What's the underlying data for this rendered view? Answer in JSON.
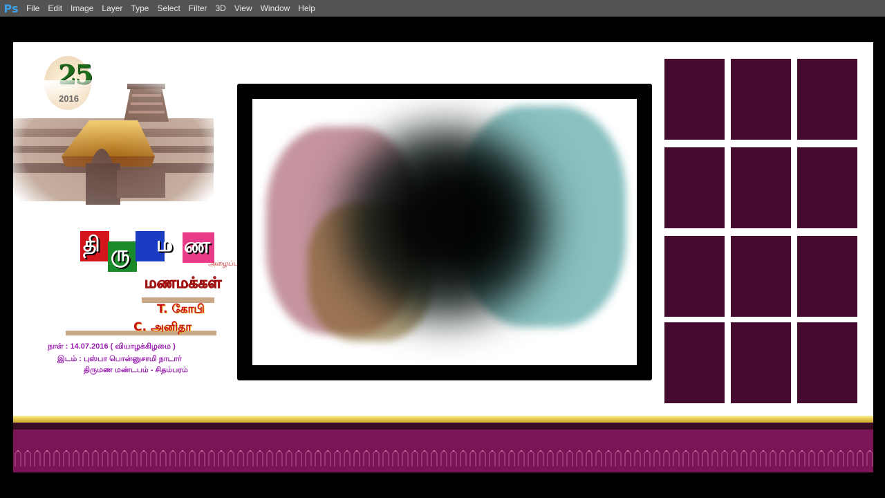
{
  "app": {
    "logo": "Ps"
  },
  "menu": [
    "File",
    "Edit",
    "Image",
    "Layer",
    "Type",
    "Select",
    "Filter",
    "3D",
    "View",
    "Window",
    "Help"
  ],
  "design": {
    "logo": {
      "number": "25",
      "year": "2016"
    },
    "title_blocks": [
      {
        "text": "தி",
        "color": "#d4151c"
      },
      {
        "text": "ரு",
        "color": "#1a8a2a"
      },
      {
        "text": "ம",
        "color": "#1a3cc2"
      },
      {
        "text": "ண",
        "color": "#e83c8a"
      }
    ],
    "title_sub": "அழைப்பு....",
    "heading": "மணமக்கள்",
    "groom": "T. கோபி",
    "bride": "C. அனிதா",
    "date_line": "நாள் : 14.07.2016 ( வியாழக்கிழமை )",
    "venue_line1": "இடம் :  புஸ்பா பொன்னுசாமி நாடார்",
    "venue_line2": "திருமண மண்டபம் - சிதம்பரம்"
  },
  "colors": {
    "grid_cell": "#450c2f",
    "border_maroon": "#7a1656",
    "border_gold": "#e6c64a",
    "info_text": "#9a1fb0"
  }
}
